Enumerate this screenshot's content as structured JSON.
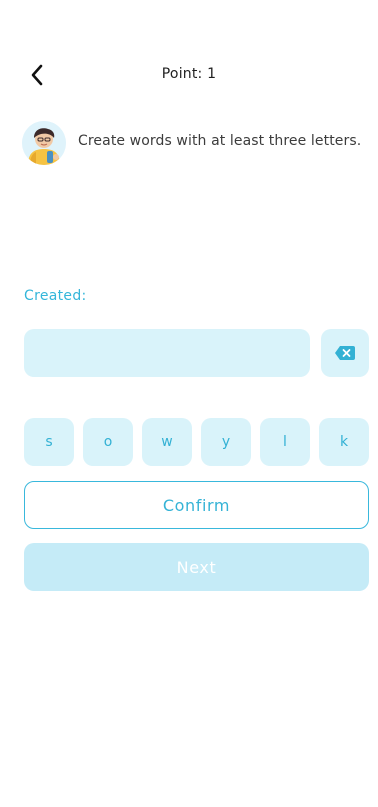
{
  "header": {
    "title": "Point: 1",
    "back_icon": "chevron-left-icon"
  },
  "instruction": {
    "avatar_icon": "child-avatar-icon",
    "text": "Create words with at least three letters."
  },
  "created": {
    "label": "Created:",
    "current_word": ""
  },
  "delete_icon": "backspace-icon",
  "letters": [
    "s",
    "o",
    "w",
    "y",
    "l",
    "k"
  ],
  "buttons": {
    "confirm": "Confirm",
    "next": "Next"
  },
  "colors": {
    "accent": "#34b6da",
    "tile_bg": "#d9f3fa",
    "next_bg": "#c5ebf7"
  }
}
